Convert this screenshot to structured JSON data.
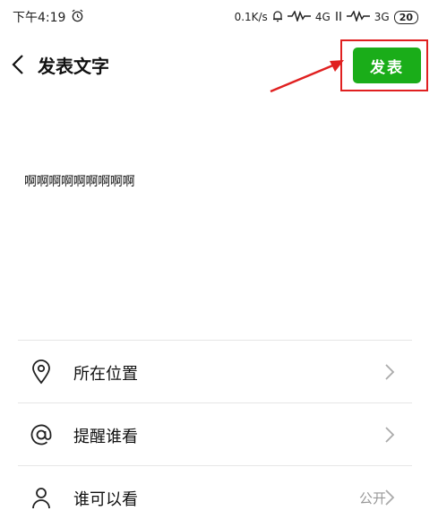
{
  "status_bar": {
    "time": "下午4:19",
    "net_speed": "0.1K/s",
    "network_1": "4G",
    "network_2": "3G",
    "battery": "20"
  },
  "header": {
    "title": "发表文字",
    "publish_label": "发表"
  },
  "post": {
    "text": "啊啊啊啊啊啊啊啊啊"
  },
  "options": [
    {
      "label": "所在位置",
      "value": ""
    },
    {
      "label": "提醒谁看",
      "value": ""
    },
    {
      "label": "谁可以看",
      "value": "公开"
    }
  ],
  "colors": {
    "publish_green": "#1aad19",
    "highlight_red": "#e02020"
  },
  "icons": {
    "location": "location-pin-icon",
    "mention": "at-sign-icon",
    "visibility": "person-icon"
  }
}
